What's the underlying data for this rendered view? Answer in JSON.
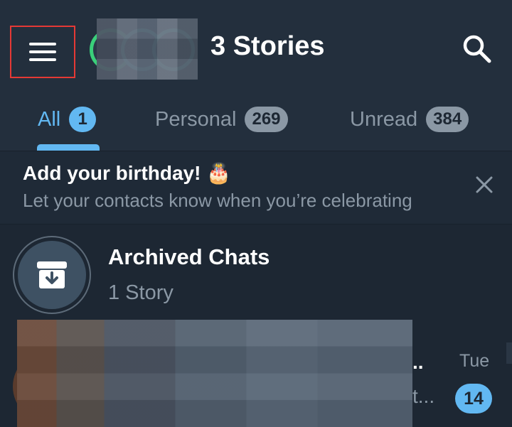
{
  "topbar": {
    "menu_icon": "hamburger-menu-icon",
    "title": "3 Stories",
    "search_icon": "search-icon",
    "story_ring_colors": [
      "#3ad07a",
      "#48c9c2",
      "#48c9c2"
    ]
  },
  "tabs": [
    {
      "label": "All",
      "badge": "1",
      "active": true
    },
    {
      "label": "Personal",
      "badge": "269",
      "active": false
    },
    {
      "label": "Unread",
      "badge": "384",
      "active": false
    }
  ],
  "banner": {
    "title": "Add your birthday! 🎂",
    "subtitle": "Let your contacts know when you’re celebrating",
    "close_icon": "close-icon"
  },
  "archived": {
    "title": "Archived Chats",
    "subtitle": "1 Story",
    "icon": "archive-box-icon"
  },
  "chat": {
    "name_tail": "..",
    "preview_tail": "t...",
    "time": "Tue",
    "unread": "14"
  },
  "colors": {
    "accent": "#62b8f2",
    "background": "#1d2733",
    "header": "#232f3d",
    "muted_text": "#8b98a5",
    "highlight_border": "#e53935"
  }
}
